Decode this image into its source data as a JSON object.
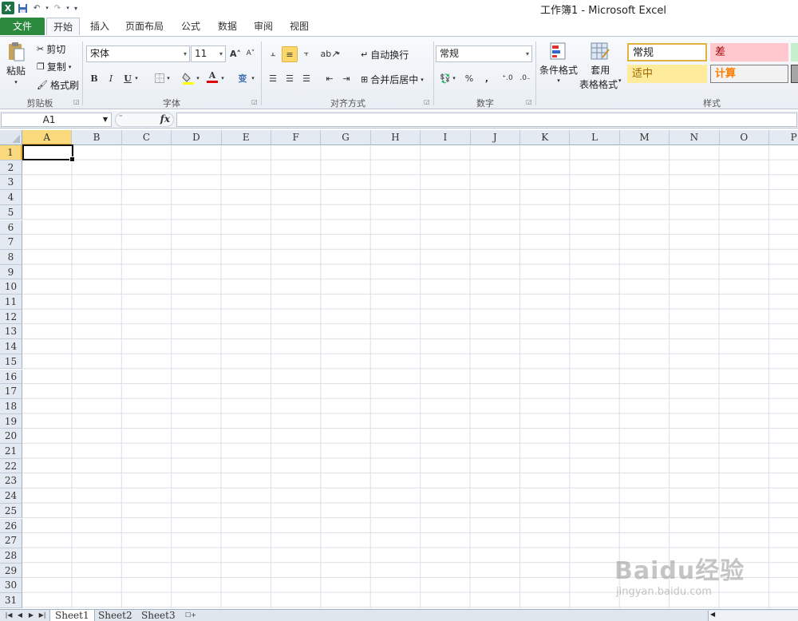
{
  "window": {
    "title": "工作簿1 - Microsoft Excel"
  },
  "qat": {
    "logo": "X"
  },
  "tabs": [
    "文件",
    "开始",
    "插入",
    "页面布局",
    "公式",
    "数据",
    "审阅",
    "视图"
  ],
  "ribbon": {
    "clipboard": {
      "label": "剪贴板",
      "paste": "粘贴",
      "cut": "剪切",
      "copy": "复制",
      "format_painter": "格式刷"
    },
    "font": {
      "label": "字体",
      "name": "宋体",
      "size": "11",
      "bold": "B",
      "italic": "I",
      "underline": "U",
      "font_color": "A",
      "phonetic": "变"
    },
    "alignment": {
      "label": "对齐方式",
      "wrap_text": "自动换行",
      "merge_center": "合并后居中"
    },
    "number": {
      "label": "数字",
      "format": "常规",
      "percent": "%",
      "comma": ","
    },
    "styles": {
      "label": "样式",
      "conditional": "条件格式",
      "table_format_1": "套用",
      "table_format_2": "表格格式",
      "s_normal": "常规",
      "s_bad": "差",
      "s_neutral": "适中",
      "s_calc": "计算"
    }
  },
  "formula_bar": {
    "name_box": "A1",
    "fx": "fx",
    "formula": ""
  },
  "columns": [
    "A",
    "B",
    "C",
    "D",
    "E",
    "F",
    "G",
    "H",
    "I",
    "J",
    "K",
    "L",
    "M",
    "N",
    "O",
    "P"
  ],
  "rows": [
    "1",
    "2",
    "3",
    "4",
    "5",
    "6",
    "7",
    "8",
    "9",
    "10",
    "11",
    "12",
    "13",
    "14",
    "15",
    "16",
    "17",
    "18",
    "19",
    "20",
    "21",
    "22",
    "23",
    "24",
    "25",
    "26",
    "27",
    "28",
    "29",
    "30",
    "31"
  ],
  "sheets": [
    "Sheet1",
    "Sheet2",
    "Sheet3"
  ],
  "watermark": {
    "brand": "Baidu经验",
    "url": "jingyan.baidu.com"
  },
  "colors": {
    "accent_green": "#2b8a3e",
    "selection": "#f9d97b"
  }
}
